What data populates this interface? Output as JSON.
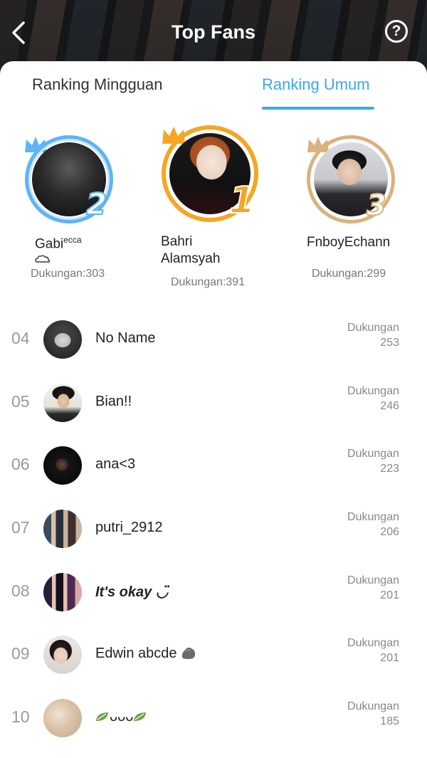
{
  "header": {
    "title": "Top Fans",
    "help_glyph": "?"
  },
  "tabs": [
    {
      "label": "Ranking Mingguan",
      "active": false
    },
    {
      "label": "Ranking Umum",
      "active": true
    }
  ],
  "colors": {
    "accent": "#3aa8ea",
    "gold": "#f5a623",
    "silver_blue": "#5fb3f5",
    "bronze": "#d9b27c"
  },
  "podium": [
    {
      "rank": "2",
      "name": "Gabi",
      "name_sup": "ecca",
      "name_icon": "cloud-icon",
      "support": "Dukungan:303"
    },
    {
      "rank": "1",
      "name_line1": "Bahri",
      "name_line2": "Alamsyah",
      "support": "Dukungan:391"
    },
    {
      "rank": "3",
      "name": "FnboyEchann",
      "support": "Dukungan:299"
    }
  ],
  "support_label": "Dukungan",
  "list": [
    {
      "rank": "04",
      "name": "No Name",
      "value": "253"
    },
    {
      "rank": "05",
      "name": "Bian!!",
      "value": "246"
    },
    {
      "rank": "06",
      "name": "ana<3",
      "value": "223"
    },
    {
      "rank": "07",
      "name": "putri_2912",
      "value": "206"
    },
    {
      "rank": "08",
      "name": "It's okay ◡̈",
      "value": "201"
    },
    {
      "rank": "09",
      "name": "Edwin abcde",
      "name_icon": "rock-icon",
      "value": "201"
    },
    {
      "rank": "10",
      "name": "ᴗᴗᴗ",
      "name_icon": "leaf-icon",
      "value": "185"
    }
  ]
}
